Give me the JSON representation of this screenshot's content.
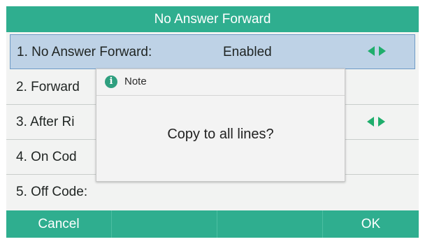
{
  "title": "No Answer Forward",
  "rows": [
    {
      "label": "1. No Answer Forward:",
      "value": "Enabled",
      "arrows": true
    },
    {
      "label": "2. Forward",
      "value": "",
      "arrows": false
    },
    {
      "label": "3. After Ri",
      "value": "",
      "arrows": true
    },
    {
      "label": "4. On Cod",
      "value": "",
      "arrows": false
    },
    {
      "label": "5. Off Code:",
      "value": "",
      "arrows": false
    }
  ],
  "softkeys": {
    "left": "Cancel",
    "k2": "",
    "k3": "",
    "right": "OK"
  },
  "dialog": {
    "title": "Note",
    "message": "Copy to all lines?",
    "icon": "info-icon"
  },
  "colors": {
    "accent": "#2fae8f",
    "selection": "#bed2e6",
    "arrow": "#1fae6c"
  }
}
